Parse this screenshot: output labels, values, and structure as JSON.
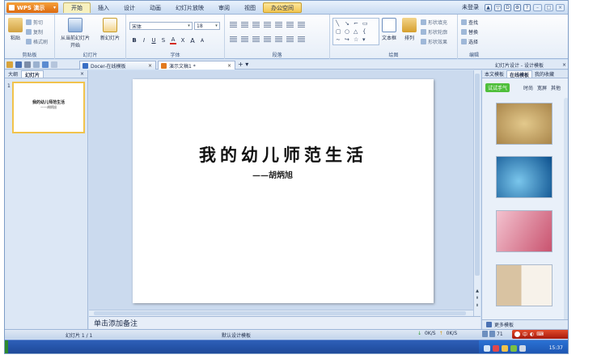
{
  "app": {
    "brand": "WPS 演示",
    "menu": [
      "开始",
      "插入",
      "设计",
      "动画",
      "幻灯片放映",
      "审阅",
      "视图",
      "办公空间"
    ],
    "login": "未登录"
  },
  "ribbon": {
    "clipboard": {
      "paste": "粘贴",
      "cut": "剪切",
      "copy": "复制",
      "format_painter": "格式刷",
      "group": "剪贴板"
    },
    "slides": {
      "from_current": "从当前幻灯片开始",
      "new_slide": "新幻灯片",
      "group": "幻灯片"
    },
    "font": {
      "name": "宋体",
      "size": "18",
      "group": "字体",
      "bold": "B",
      "italic": "I",
      "underline": "U",
      "shadow": "S",
      "color": "A",
      "clear": "X",
      "grow": "A",
      "shrink": "A"
    },
    "paragraph": {
      "group": "段落"
    },
    "drawing": {
      "textbox": "文本框",
      "arrange": "排列",
      "shape_fill": "形状填充",
      "shape_outline": "形状轮廓",
      "shape_effect": "形状效果",
      "group": "绘图"
    },
    "editing": {
      "find": "查找",
      "replace": "替换",
      "select": "选择",
      "group": "编辑"
    }
  },
  "tabs": {
    "template_tab": "Docer-在线模板",
    "doc_tab": "演示文稿1 *",
    "right_panel_title": "幻灯片设计 - 设计模板"
  },
  "left_panel": {
    "tabs": [
      "大纲",
      "幻灯片"
    ],
    "slide_number": "1",
    "thumb_title": "我的幼儿师范生活",
    "thumb_sub": "——胡炳旭"
  },
  "slide": {
    "title": "我的幼儿师范生活",
    "subtitle": "——胡炳旭"
  },
  "notes": {
    "placeholder": "单击添加备注"
  },
  "right_panel": {
    "tabs": [
      "本文模板",
      "在线模板",
      "我的收藏"
    ],
    "try_label": "试试手气",
    "filters": [
      "时尚",
      "宽屏",
      "其他"
    ],
    "more_templates": "更多模板"
  },
  "status": {
    "slide_info": "幻灯片 1 / 1",
    "design": "默认设计模板",
    "down": "0K/S",
    "up": "0K/S",
    "zoom": "71"
  },
  "taskbar": {
    "clock": "15:37"
  },
  "colors": {
    "accent_orange": "#e0761a",
    "office_space_tab": "#f2c651",
    "selected_thumb_border": "#f1c34c",
    "try_button": "#4fbf3b"
  }
}
